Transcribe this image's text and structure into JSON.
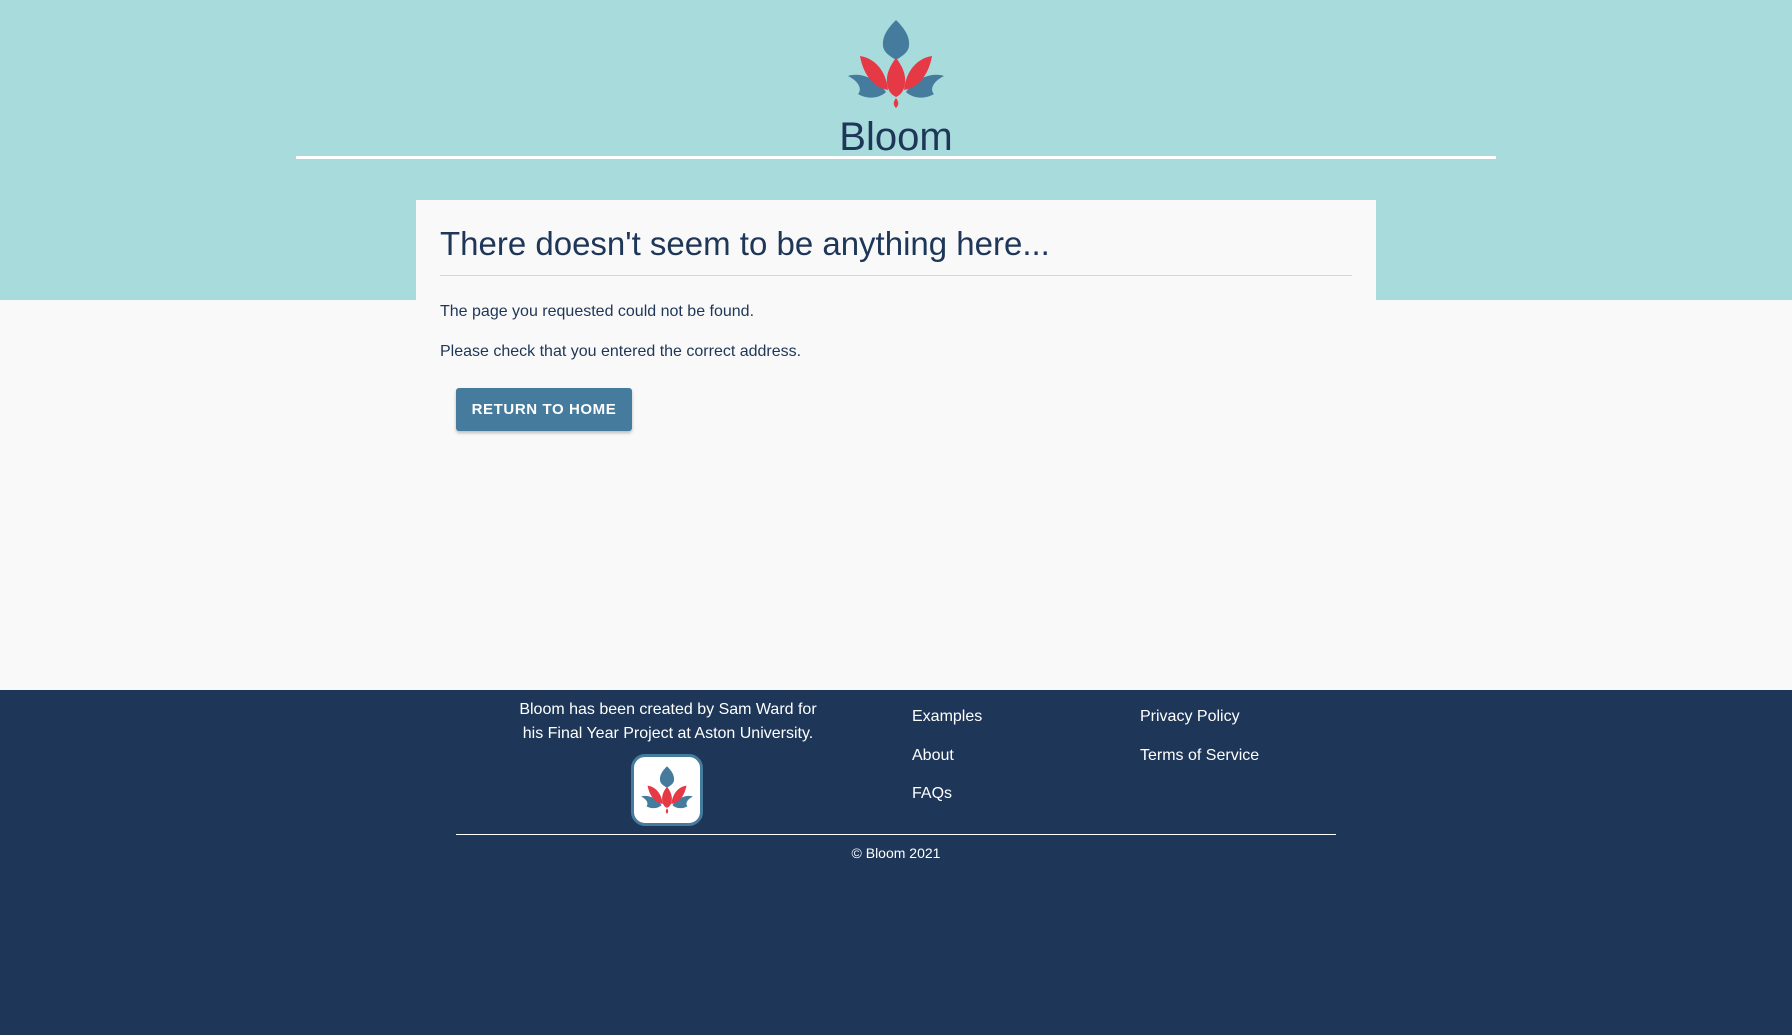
{
  "header": {
    "logo_text": "Bloom",
    "logo_icon": "lotus-icon"
  },
  "not_found": {
    "title": "There doesn't seem to be anything here...",
    "message_1": "The page you requested could not be found.",
    "message_2": "Please check that you entered the correct address.",
    "return_button": "RETURN TO HOME"
  },
  "footer": {
    "blurb": "Bloom has been created by Sam Ward for his Final Year Project at Aston University.",
    "logo_icon": "lotus-icon",
    "links_col1": [
      "Examples",
      "About",
      "FAQs"
    ],
    "links_col2": [
      "Privacy Policy",
      "Terms of Service"
    ],
    "copyright": "© Bloom 2021"
  },
  "colors": {
    "hero_background": "#a8dbdb",
    "page_background": "#f9f9f9",
    "navy": "#1e3657",
    "button_blue": "#457b9d",
    "lotus_red": "#e63946"
  }
}
